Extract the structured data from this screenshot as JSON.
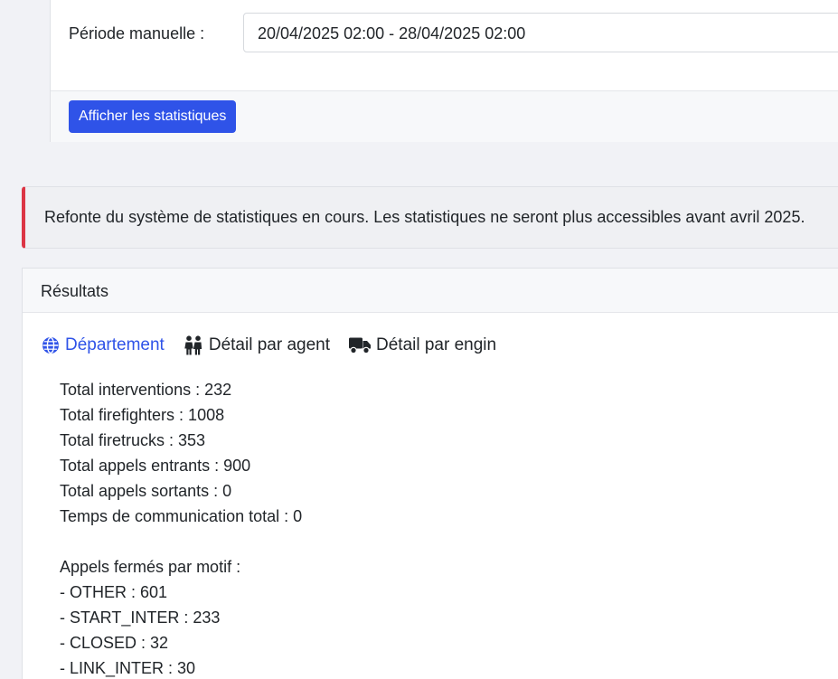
{
  "filter": {
    "period_label": "Période manuelle :",
    "period_value": "20/04/2025 02:00 - 28/04/2025 02:00",
    "submit_label": "Afficher les statistiques"
  },
  "alert": {
    "message": "Refonte du système de statistiques en cours. Les statistiques ne seront plus accessibles avant avril 2025.",
    "color": "#dc3545"
  },
  "results": {
    "title": "Résultats",
    "tabs": [
      {
        "label": "Département",
        "icon": "globe-icon",
        "active": true
      },
      {
        "label": "Détail par agent",
        "icon": "people-icon",
        "active": false
      },
      {
        "label": "Détail par engin",
        "icon": "truck-icon",
        "active": false
      }
    ],
    "totals": [
      "Total interventions : 232",
      "Total firefighters : 1008",
      "Total firetrucks : 353",
      "Total appels entrants : 900",
      "Total appels sortants : 0",
      "Temps de communication total : 0"
    ],
    "closed_heading": "Appels fermés par motif :",
    "closed_reasons": [
      "- OTHER : 601",
      "- START_INTER : 233",
      "- CLOSED : 32",
      "- LINK_INTER : 30"
    ]
  },
  "colors": {
    "accent": "#2f53e8",
    "background": "#f1f2f6"
  }
}
